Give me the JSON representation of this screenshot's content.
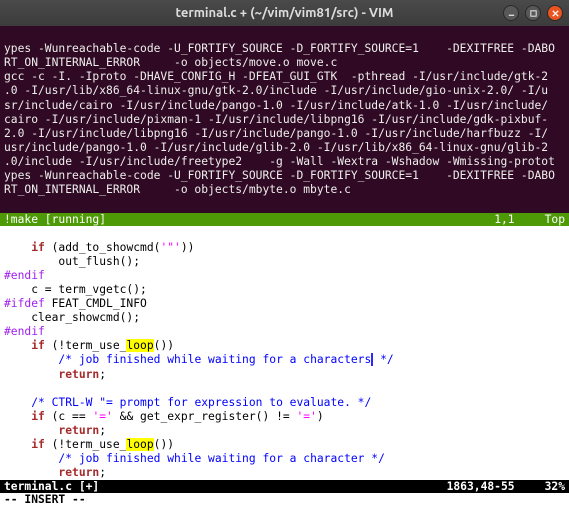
{
  "window": {
    "title": "terminal.c + (~/vim/vim81/src) - VIM"
  },
  "terminal": {
    "lines": [
      "ypes -Wunreachable-code -U_FORTIFY_SOURCE -D_FORTIFY_SOURCE=1    -DEXITFREE -DABO",
      "RT_ON_INTERNAL_ERROR     -o objects/move.o move.c",
      "gcc -c -I. -Iproto -DHAVE_CONFIG_H -DFEAT_GUI_GTK  -pthread -I/usr/include/gtk-2",
      ".0 -I/usr/lib/x86_64-linux-gnu/gtk-2.0/include -I/usr/include/gio-unix-2.0/ -I/u",
      "sr/include/cairo -I/usr/include/pango-1.0 -I/usr/include/atk-1.0 -I/usr/include/",
      "cairo -I/usr/include/pixman-1 -I/usr/include/libpng16 -I/usr/include/gdk-pixbuf-",
      "2.0 -I/usr/include/libpng16 -I/usr/include/pango-1.0 -I/usr/include/harfbuzz -I/",
      "usr/include/pango-1.0 -I/usr/include/glib-2.0 -I/usr/lib/x86_64-linux-gnu/glib-2",
      ".0/include -I/usr/include/freetype2    -g -Wall -Wextra -Wshadow -Wmissing-protot",
      "ypes -Wunreachable-code -U_FORTIFY_SOURCE -D_FORTIFY_SOURCE=1    -DEXITFREE -DABO",
      "RT_ON_INTERNAL_ERROR     -o objects/mbyte.o mbyte.c",
      ""
    ]
  },
  "make_status": {
    "left": "!make [running]",
    "pos": "1,1",
    "right": "Top"
  },
  "code": {
    "l0_if": "if",
    "l0_rest": " (add_to_showcmd(",
    "l0_str": "'\"'",
    "l0_rest2": "))",
    "l1": "        out_flush();",
    "l2": "#endif",
    "l3": "    c = term_vgetc();",
    "l4_pp": "#ifdef",
    "l4_rest": " FEAT_CMDL_INFO",
    "l5": "    clear_showcmd();",
    "l6": "#endif",
    "l7_if": "if",
    "l7_rest": " (!term_use_",
    "l7_hl": "loop",
    "l7_rest2": "())",
    "l8_cmt": "/* job finished while waiting for a characters",
    "l8_cmt2": " */",
    "l9_ret": "return",
    "l9_rest": ";",
    "l10": "",
    "l11_cmt": "/* CTRL-W \"= prompt for expression to evaluate. */",
    "l12_if": "if",
    "l12_rest": " (c == ",
    "l12_str1": "'='",
    "l12_rest2": " && get_expr_register() != ",
    "l12_str2": "'='",
    "l12_rest3": ")",
    "l13_ret": "return",
    "l13_rest": ";",
    "l14_if": "if",
    "l14_rest": " (!term_use_",
    "l14_hl": "loop",
    "l14_rest2": "())",
    "l15_cmt": "/* job finished while waiting for a character */",
    "l16_ret": "return",
    "l16_rest": ";"
  },
  "statusline": {
    "fname": "terminal.c [+]",
    "pos": "1863,48-55",
    "pct": "32%"
  },
  "cmdline": "-- INSERT --"
}
